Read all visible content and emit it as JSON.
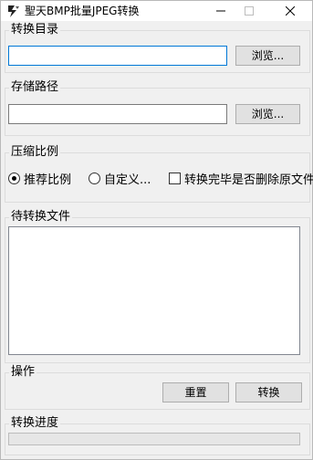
{
  "window": {
    "title": "聖天BMP批量JPEG转换"
  },
  "convert_dir": {
    "label": "转换目录",
    "value": "",
    "browse_label": "浏览..."
  },
  "save_path": {
    "label": "存储路径",
    "value": "",
    "browse_label": "浏览..."
  },
  "compression": {
    "label": "压缩比例",
    "recommended_label": "推荐比例",
    "recommended_checked": true,
    "custom_label": "自定义...",
    "custom_checked": false,
    "delete_label": "转换完毕是否删除原文件",
    "delete_checked": false
  },
  "pending_files": {
    "label": "待转换文件",
    "items": []
  },
  "actions": {
    "label": "操作",
    "reset_label": "重置",
    "convert_label": "转换"
  },
  "progress": {
    "label": "转换进度",
    "value": 0
  }
}
